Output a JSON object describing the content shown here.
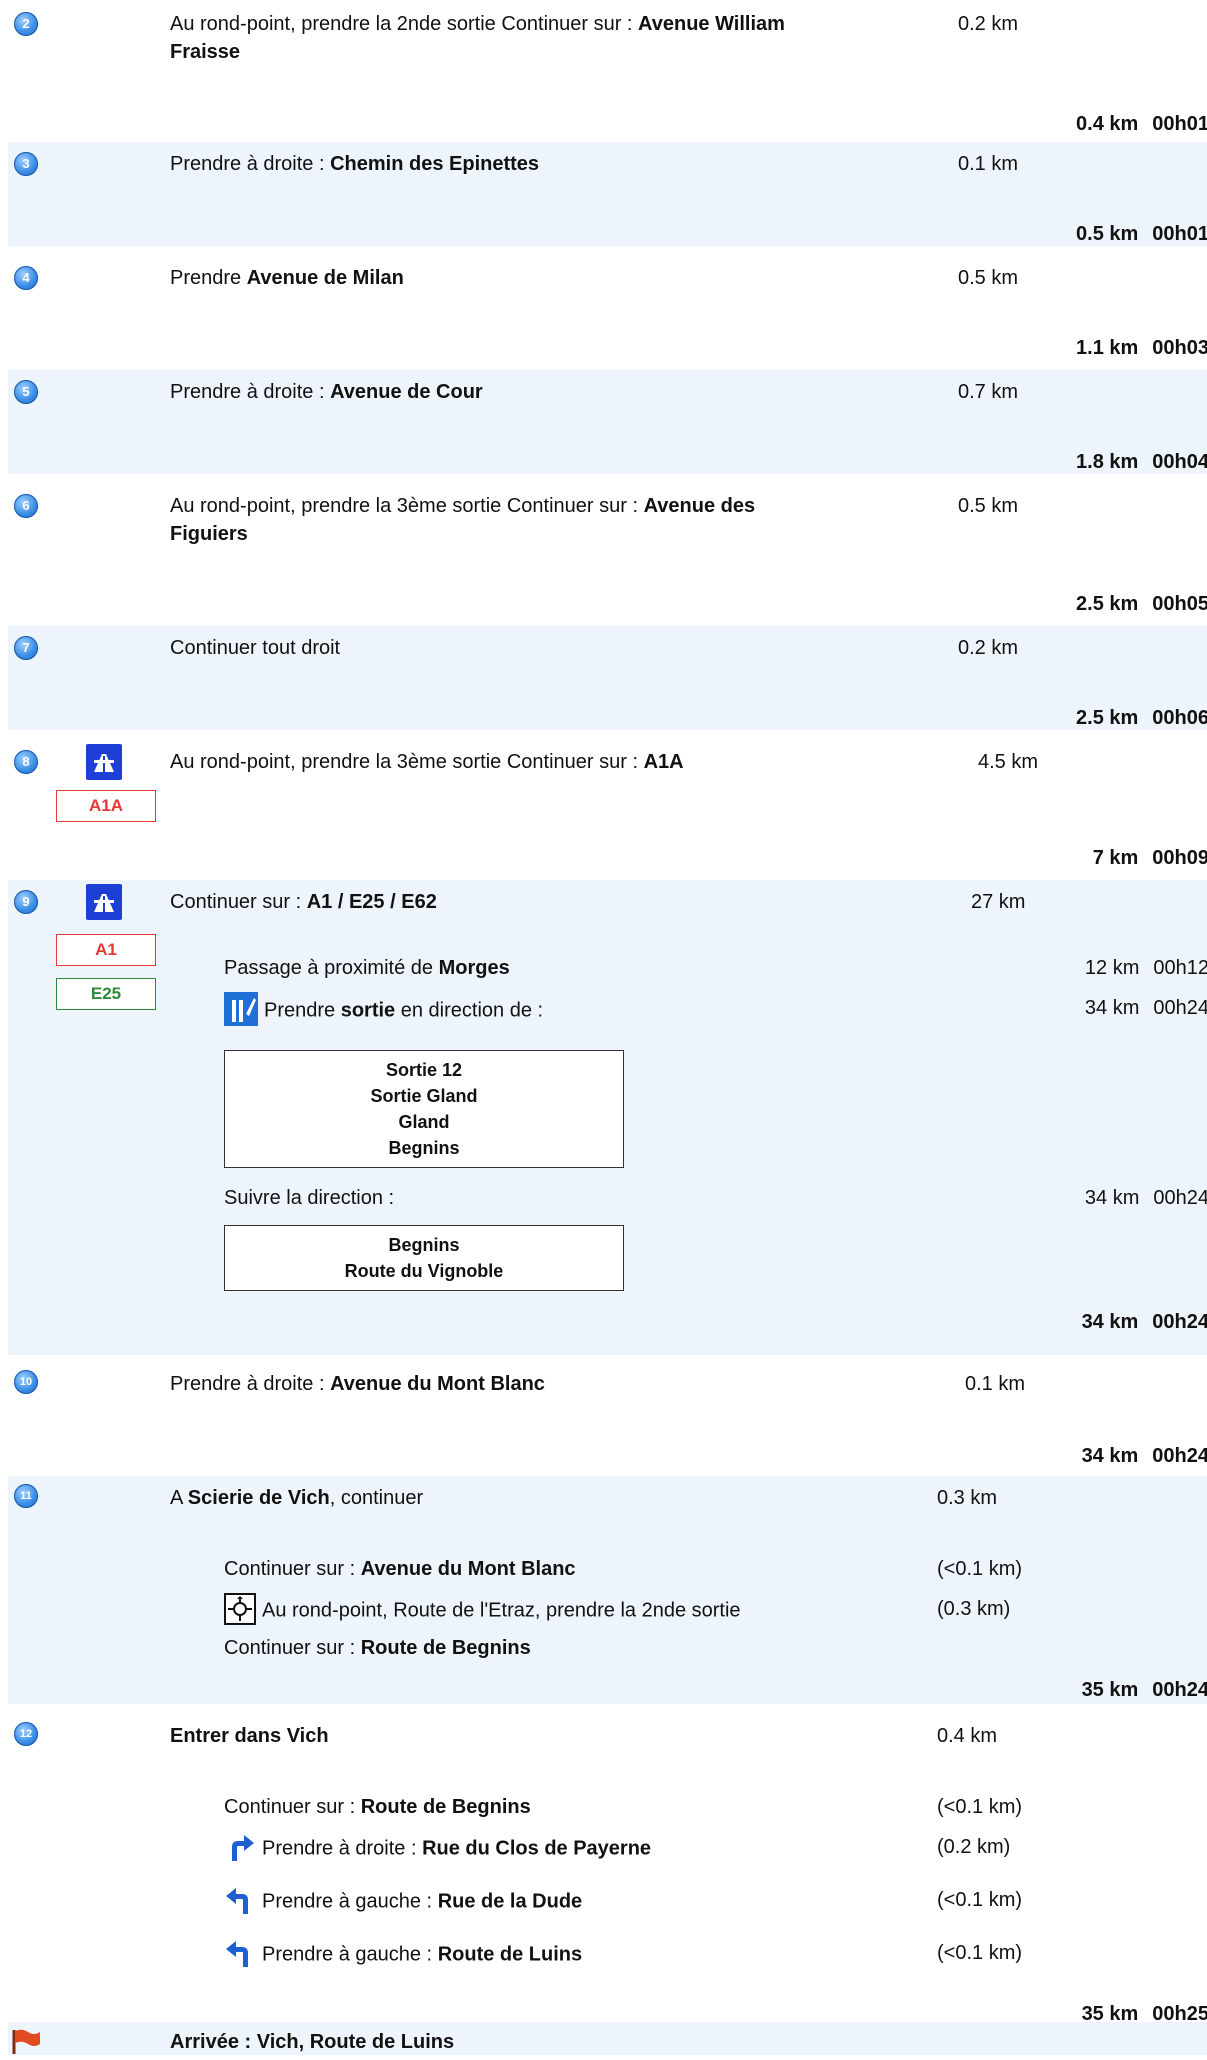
{
  "steps": [
    {
      "num": "2",
      "prefix": "Au rond-point, prendre la 2nde sortie Continuer sur : ",
      "bold": "Avenue William",
      "bold2": "Fraisse",
      "dist": "0.2 km",
      "cum_dist": "0.4 km",
      "cum_time": "00h01"
    },
    {
      "num": "3",
      "prefix": "Prendre à droite : ",
      "bold": "Chemin des Epinettes",
      "dist": "0.1 km",
      "cum_dist": "0.5 km",
      "cum_time": "00h01"
    },
    {
      "num": "4",
      "prefix": "Prendre ",
      "bold": "Avenue de Milan",
      "dist": "0.5 km",
      "cum_dist": "1.1 km",
      "cum_time": "00h03"
    },
    {
      "num": "5",
      "prefix": "Prendre à droite : ",
      "bold": "Avenue de Cour",
      "dist": "0.7 km",
      "cum_dist": "1.8 km",
      "cum_time": "00h04"
    },
    {
      "num": "6",
      "prefix": "Au rond-point, prendre la 3ème sortie Continuer sur : ",
      "bold": "Avenue des",
      "bold2": "Figuiers",
      "dist": "0.5 km",
      "cum_dist": "2.5 km",
      "cum_time": "00h05"
    },
    {
      "num": "7",
      "prefix": "Continuer tout droit",
      "bold": "",
      "dist": "0.2 km",
      "cum_dist": "2.5 km",
      "cum_time": "00h06"
    },
    {
      "num": "8",
      "prefix": "Au rond-point, prendre la 3ème sortie Continuer sur : ",
      "bold": "A1A",
      "dist": "4.5 km",
      "road": "A1A",
      "cum_dist": "7 km",
      "cum_time": "00h09"
    },
    {
      "num": "9",
      "prefix": "Continuer sur : ",
      "bold": "A1 / E25 / E62",
      "dist": "27 km",
      "road1": "A1",
      "road2": "E25",
      "pass_prefix": "Passage à proximité de ",
      "pass_bold": "Morges",
      "pass_dist": "12 km",
      "pass_time": "00h12",
      "exit_prefix": "Prendre ",
      "exit_bold": "sortie",
      "exit_suffix": " en direction de :",
      "exit_dist": "34 km",
      "exit_time": "00h24",
      "sign1": [
        "Sortie 12",
        "Sortie Gland",
        "Gland",
        "Begnins"
      ],
      "follow": "Suivre la direction :",
      "follow_dist": "34 km",
      "follow_time": "00h24",
      "sign2": [
        "Begnins",
        "Route du Vignoble"
      ],
      "cum_dist": "34 km",
      "cum_time": "00h24"
    },
    {
      "num": "10",
      "prefix": "Prendre à droite : ",
      "bold": "Avenue du Mont Blanc",
      "dist": "0.1 km",
      "cum_dist": "34 km",
      "cum_time": "00h24"
    },
    {
      "num": "11",
      "prefix": "A ",
      "bold": "Scierie de Vich",
      "suffix": ", continuer",
      "dist": "0.3 km",
      "s1_prefix": "Continuer sur : ",
      "s1_bold": "Avenue du Mont Blanc",
      "s1_dist": "(<0.1 km)",
      "s2_text": "Au rond-point, Route de l'Etraz, prendre la 2nde sortie",
      "s2_dist": "(0.3 km)",
      "s3_prefix": "Continuer sur : ",
      "s3_bold": "Route de Begnins",
      "cum_dist": "35 km",
      "cum_time": "00h24"
    },
    {
      "num": "12",
      "bold": "Entrer dans Vich",
      "dist": "0.4 km",
      "s1_prefix": "Continuer sur : ",
      "s1_bold": "Route de Begnins",
      "s1_dist": "(<0.1 km)",
      "s2_prefix": "Prendre à droite : ",
      "s2_bold": "Rue du Clos de Payerne",
      "s2_dist": "(0.2 km)",
      "s3_prefix": "Prendre à gauche : ",
      "s3_bold": "Rue de la Dude",
      "s3_dist": "(<0.1 km)",
      "s4_prefix": "Prendre à gauche : ",
      "s4_bold": "Route de Luins",
      "s4_dist": "(<0.1 km)",
      "cum_dist": "35 km",
      "cum_time": "00h25"
    }
  ],
  "arrival": "Arrivée : Vich, Route de Luins",
  "colors": {
    "accent": "#1d3fd6",
    "alt_row": "#eef4fb",
    "road_red": "#e53935",
    "road_green": "#2e8b3a"
  }
}
